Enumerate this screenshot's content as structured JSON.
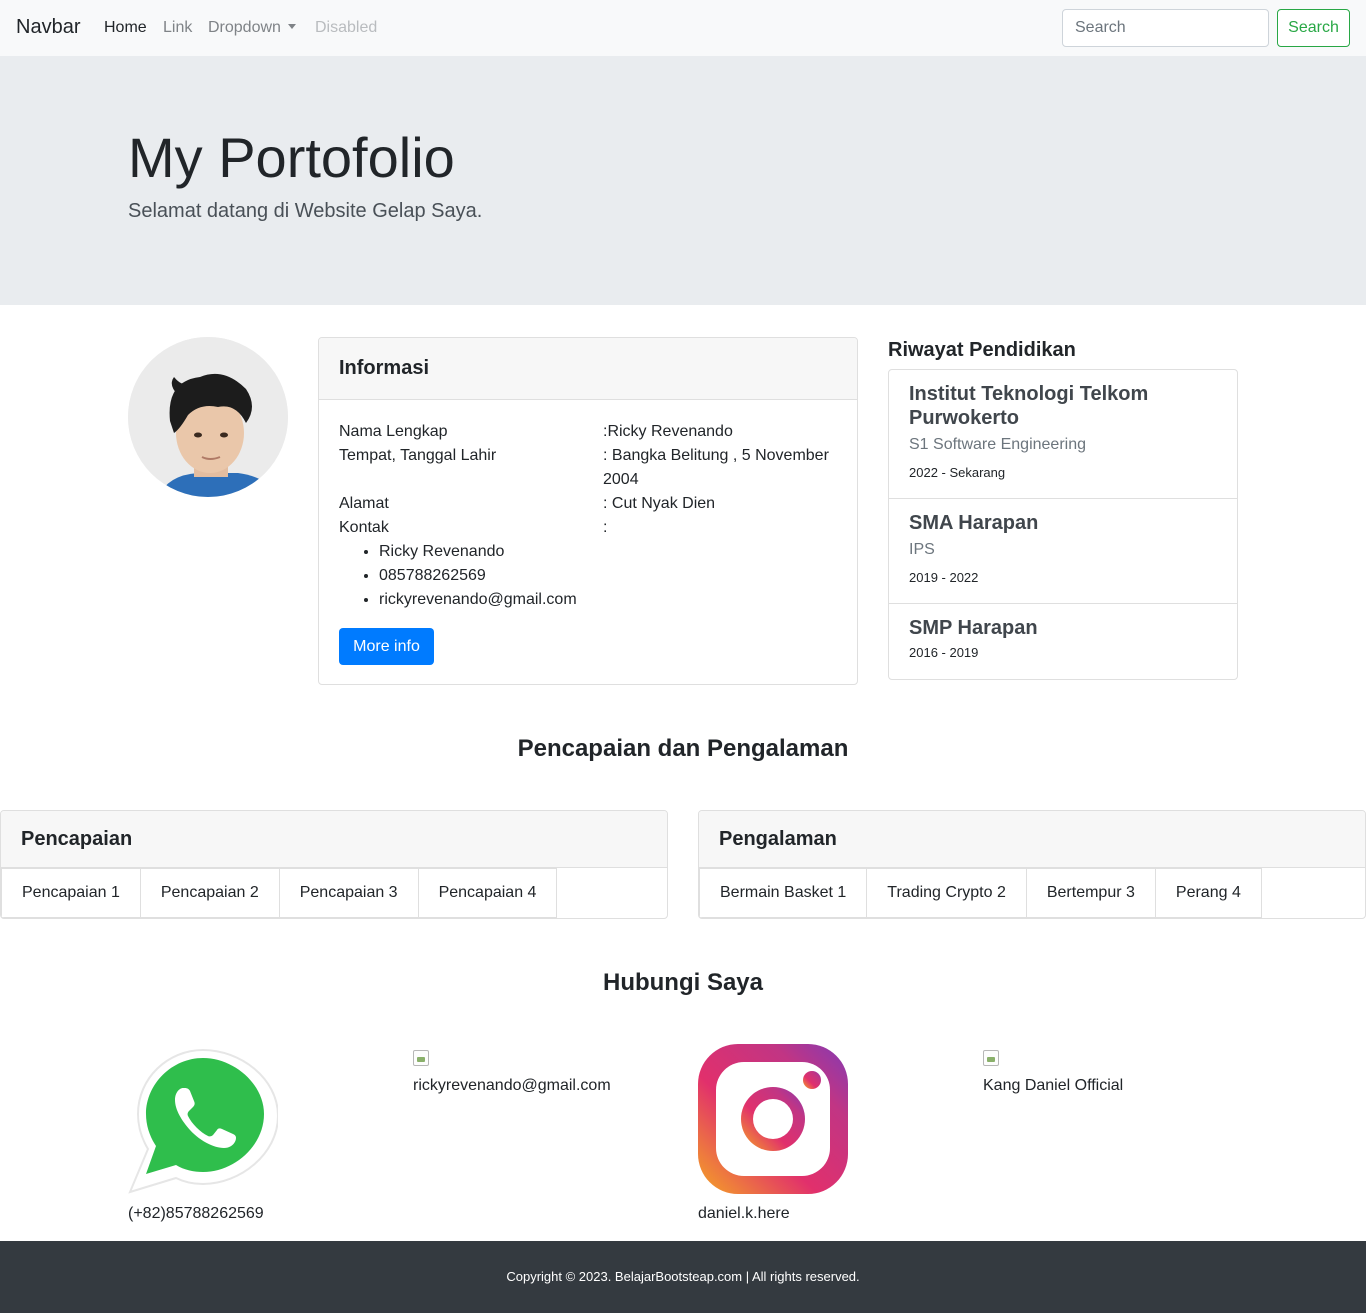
{
  "navbar": {
    "brand": "Navbar",
    "links": [
      "Home",
      "Link",
      "Dropdown",
      "Disabled"
    ],
    "search_placeholder": "Search",
    "search_button": "Search"
  },
  "jumbotron": {
    "title": "My Portofolio",
    "subtitle": "Selamat datang di Website Gelap Saya."
  },
  "info_card": {
    "header": "Informasi",
    "rows": [
      {
        "label": "Nama Lengkap",
        "value": ":Ricky Revenando"
      },
      {
        "label": "Tempat, Tanggal Lahir",
        "value": ": Bangka Belitung , 5 November 2004"
      },
      {
        "label": "Alamat",
        "value": ": Cut Nyak Dien"
      },
      {
        "label": "Kontak",
        "value": ":"
      }
    ],
    "contacts": [
      "Ricky Revenando",
      "085788262569",
      "rickyrevenando@gmail.com"
    ],
    "button": "More info"
  },
  "education": {
    "title": "Riwayat Pendidikan",
    "items": [
      {
        "school": "Institut Teknologi Telkom Purwokerto",
        "major": "S1 Software Engineering",
        "years": "2022 - Sekarang"
      },
      {
        "school": "SMA Harapan",
        "major": "IPS",
        "years": "2019 - 2022"
      },
      {
        "school": "SMP Harapan",
        "major": "",
        "years": "2016 - 2019"
      }
    ]
  },
  "achievements_section": {
    "title": "Pencapaian dan Pengalaman",
    "pencapaian": {
      "header": "Pencapaian",
      "items": [
        "Pencapaian 1",
        "Pencapaian 2",
        "Pencapaian 3",
        "Pencapaian 4"
      ]
    },
    "pengalaman": {
      "header": "Pengalaman",
      "items": [
        "Bermain Basket 1",
        "Trading Crypto 2",
        "Bertempur 3",
        "Perang 4"
      ]
    }
  },
  "contact_section": {
    "title": "Hubungi Saya",
    "whatsapp": "(+82)85788262569",
    "email": "rickyrevenando@gmail.com",
    "instagram": "daniel.k.here",
    "youtube": "Kang Daniel Official"
  },
  "footer": {
    "text": "Copyright © 2023. BelajarBootsteap.com | All rights reserved."
  },
  "colors": {
    "primary": "#007bff",
    "success": "#28a745",
    "jumbotron_bg": "#e9ecef",
    "footer_bg": "#343a40",
    "whatsapp_green": "#25d366"
  }
}
